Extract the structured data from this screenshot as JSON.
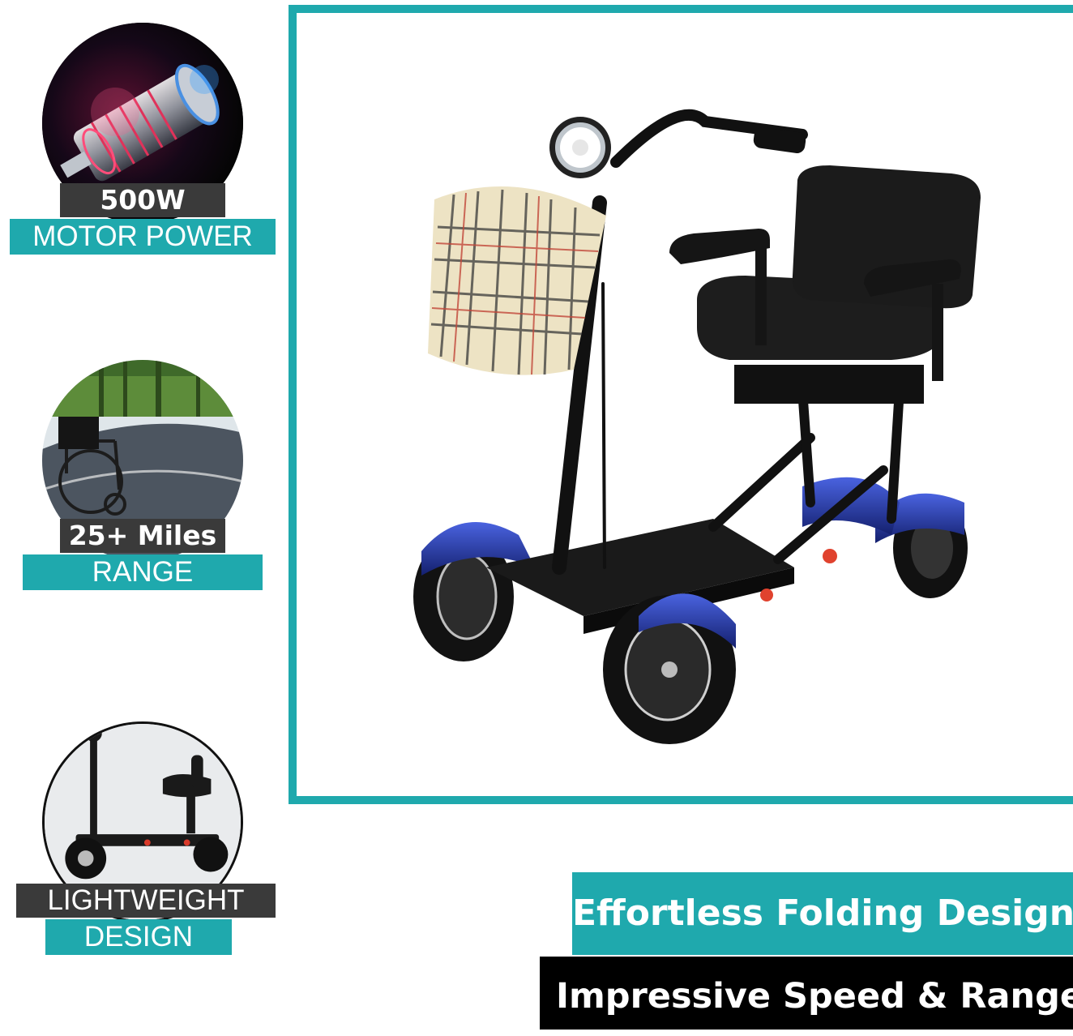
{
  "features": [
    {
      "title": "500W",
      "subtitle": "MOTOR POWER",
      "image": "motor-icon"
    },
    {
      "title": "25+ Miles",
      "subtitle": "RANGE",
      "image": "wheelchair-road-icon"
    },
    {
      "title": "LIGHTWEIGHT",
      "subtitle": "DESIGN",
      "image": "folded-scooter-icon"
    }
  ],
  "banners": {
    "folding": "Effortless Folding Design",
    "speed": "Impressive Speed & Range"
  },
  "product": {
    "image": "mobility-scooter-icon"
  },
  "colors": {
    "accent": "#1fa9ad",
    "dark_label": "#3a3a3a",
    "scooter_blue": "#1f2f9e",
    "black": "#000000"
  }
}
